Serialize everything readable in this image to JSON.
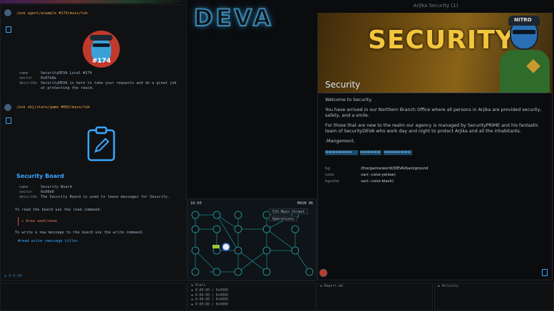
{
  "left_panel": {
    "topbar_indicator": "●",
    "agent_block": {
      "command": "/ask agent/example #174/main/tok",
      "avatar_badge": "#174",
      "rows": [
        {
          "key": "name",
          "value": "SecurityDEVA Local #174"
        },
        {
          "key": "vector",
          "value": "0x07e8e"
        },
        {
          "key": "describe",
          "value": "SecurityDEVA is here to take your requests and do a great job at protecting the realm."
        }
      ]
    },
    "board_block": {
      "command": "/ask obj/state/game #002/main/tok",
      "title": "Security Board",
      "rows": [
        {
          "key": "name",
          "value": "Security Board"
        },
        {
          "key": "vector",
          "value": "0x00e0"
        },
        {
          "key": "describe",
          "value": "The Security Board is used to leave messages for Security."
        }
      ],
      "read_hint": "To read the board use the read command.",
      "empty_notice": "☐ Area seat/none",
      "write_hint": "To write a new message to the board use the write command.",
      "write_example": "#read write <message title>"
    },
    "footer": "▪ 0:0:00"
  },
  "logo": "DEVA",
  "security": {
    "window_title": "Arjika Security (1)",
    "banner_title": "SECURITY",
    "banner_mascot_tag": "NITRO",
    "heading": "Security",
    "paragraphs": [
      "Welcome to Security.",
      "You have arrived in our Northern Branch Office where all persons in Arjika are provided security, safety, and a smile.",
      "For those that are new to the realm our agency is managed by SecurityPRIME and his fantastic team of SecurityDEVA who work day and night to protect Arjika and all the inhabitants.",
      "-Mangement."
    ],
    "table_headers": [
      "▬▬▬▬▬▬▬▬",
      "▬▬▬▬▬▬",
      "▬▬▬▬▬▬▬▬"
    ],
    "table_rows": [
      {
        "key": "bg",
        "value": "/the/game/world/DEVA/background"
      },
      {
        "key": "color",
        "value": "var(--color-yellow)"
      },
      {
        "key": "bgcolor",
        "value": "var(--color-black)"
      }
    ]
  },
  "map": {
    "time_left": "16:50",
    "time_right": "MAIN 06",
    "location_label": "5th Main Street",
    "operations_label": "Operations"
  },
  "bottom": {
    "panel1_lines": [
      "▪ Stats",
      "▪ 0:00:00 / 0x0000",
      "▪ 0:00:00 / 0x0000",
      "▪ 0:00:00 / 0x0000",
      "▪ 0:00:00 / 0x0000"
    ],
    "panel2_label": "▪ Report.md",
    "panel3_label": "▪ Activity"
  },
  "colors": {
    "accent_blue": "#3aa6ff",
    "command_orange": "#f0a34a",
    "banner_gold": "#f2c53d"
  }
}
